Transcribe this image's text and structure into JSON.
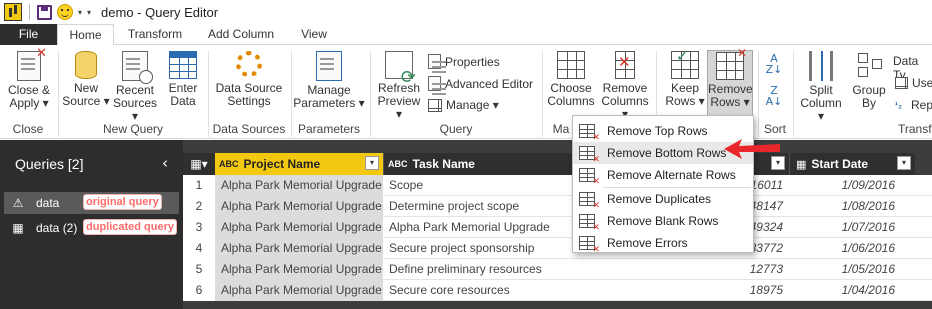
{
  "window": {
    "title": "demo - Query Editor"
  },
  "tabs": [
    "File",
    "Home",
    "Transform",
    "Add Column",
    "View"
  ],
  "ribbon": {
    "close": {
      "btn": "Close &\nApply",
      "label1": "Close &",
      "label2": "Apply ▾",
      "group": "Close"
    },
    "new_query": {
      "new_source": [
        "New",
        "Source ▾"
      ],
      "recent_sources": [
        "Recent",
        "Sources ▾"
      ],
      "enter_data": [
        "Enter",
        "Data"
      ],
      "group": "New Query"
    },
    "data_sources": {
      "btn": [
        "Data Source",
        "Settings"
      ],
      "group": "Data Sources"
    },
    "parameters": {
      "btn": [
        "Manage",
        "Parameters ▾"
      ],
      "group": "Parameters"
    },
    "query": {
      "refresh": [
        "Refresh",
        "Preview ▾"
      ],
      "properties": "Properties",
      "advanced_editor": "Advanced Editor",
      "manage": "Manage ▾",
      "group": "Query"
    },
    "manage_columns": {
      "choose": [
        "Choose",
        "Columns"
      ],
      "remove": [
        "Remove",
        "Columns ▾"
      ],
      "group": "Ma"
    },
    "reduce_rows": {
      "keep": [
        "Keep",
        "Rows ▾"
      ],
      "remove": [
        "Remove",
        "Rows ▾"
      ]
    },
    "sort": {
      "group": "Sort"
    },
    "transform": {
      "split": [
        "Split",
        "Column ▾"
      ],
      "group_by": [
        "Group",
        "By"
      ],
      "data_type": "Data Ty",
      "use_first": "Use",
      "replace": "Rep",
      "group": "Transf"
    }
  },
  "sidebar": {
    "title": "Queries [2]",
    "queries": [
      {
        "name": "data",
        "tag": "original query",
        "icon": "warning-icon"
      },
      {
        "name": "data (2)",
        "tag": "duplicated query",
        "icon": "table-icon"
      }
    ]
  },
  "grid": {
    "columns": [
      {
        "type": "ABC",
        "name": "Project Name"
      },
      {
        "type": "ABC",
        "name": "Task Name"
      },
      {
        "type": "",
        "name": ""
      },
      {
        "type": "cal",
        "name": "Start Date"
      }
    ],
    "rows": [
      {
        "n": "1",
        "project": "Alpha Park Memorial Upgrade",
        "task": "Scope",
        "value": "16011",
        "date": "1/09/2016"
      },
      {
        "n": "2",
        "project": "Alpha Park Memorial Upgrade",
        "task": "Determine project scope",
        "value": "48147",
        "date": "1/08/2016"
      },
      {
        "n": "3",
        "project": "Alpha Park Memorial Upgrade",
        "task": "Alpha Park Memorial Upgrade",
        "value": "49324",
        "date": "1/07/2016"
      },
      {
        "n": "4",
        "project": "Alpha Park Memorial Upgrade",
        "task": "Secure project sponsorship",
        "value": "33772",
        "date": "1/06/2016"
      },
      {
        "n": "5",
        "project": "Alpha Park Memorial Upgrade",
        "task": "Define preliminary resources",
        "value": "12773",
        "date": "1/05/2016"
      },
      {
        "n": "6",
        "project": "Alpha Park Memorial Upgrade",
        "task": "Secure core resources",
        "value": "18975",
        "date": "1/04/2016"
      }
    ]
  },
  "menu": {
    "items": [
      "Remove Top Rows",
      "Remove Bottom Rows",
      "Remove Alternate Rows",
      "Remove Duplicates",
      "Remove Blank Rows",
      "Remove Errors"
    ]
  },
  "colors": {
    "accent": "#f2c811",
    "dark": "#2d2d2d",
    "annotation": "#e8262b"
  }
}
